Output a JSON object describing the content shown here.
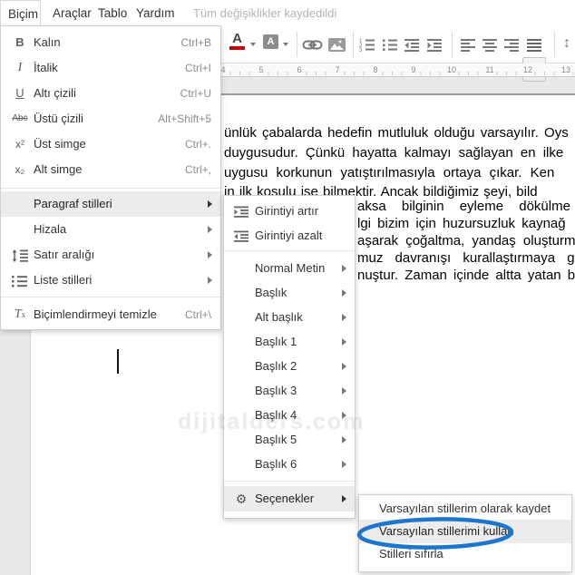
{
  "menubar": {
    "items": [
      {
        "label": "Biçim"
      },
      {
        "label": "Araçlar"
      },
      {
        "label": "Tablo"
      },
      {
        "label": "Yardım"
      }
    ],
    "status": "Tüm değişiklikler kaydedildi"
  },
  "toolbar": {
    "icons": [
      "text-color",
      "highlight-color",
      "insert-link",
      "insert-image",
      "numbered-list",
      "bulleted-list",
      "decrease-indent",
      "increase-indent",
      "align-left",
      "align-center",
      "align-right",
      "justify",
      "line-spacing"
    ],
    "justify_selected": true,
    "line_spacing_glyph": "↕"
  },
  "ruler": {
    "numbers": [
      "4",
      "5",
      "6",
      "7",
      "8",
      "9",
      "10",
      "11",
      "12",
      "13"
    ]
  },
  "format_menu": {
    "items": [
      {
        "label": "Kalın",
        "shortcut": "Ctrl+B"
      },
      {
        "label": "İtalik",
        "shortcut": "Ctrl+I"
      },
      {
        "label": "Altı çizili",
        "shortcut": "Ctrl+U"
      },
      {
        "label": "Üstü çizili",
        "shortcut": "Alt+Shift+5"
      },
      {
        "label": "Üst simge",
        "shortcut": "Ctrl+."
      },
      {
        "label": "Alt simge",
        "shortcut": "Ctrl+,"
      },
      {
        "label": "Paragraf stilleri"
      },
      {
        "label": "Hizala"
      },
      {
        "label": "Satır aralığı"
      },
      {
        "label": "Liste stilleri"
      },
      {
        "label": "Biçimlendirmeyi temizle",
        "shortcut": "Ctrl+\\"
      }
    ],
    "icon_glyphs": {
      "bold": "B",
      "italic": "I",
      "underline": "U",
      "strikethrough": "Abc",
      "superscript": "x²",
      "subscript": "x₂",
      "clear_t": "T",
      "clear_x": "x"
    }
  },
  "styles_submenu": {
    "items": [
      {
        "label": "Girintiyi artır"
      },
      {
        "label": "Girintiyi azalt"
      },
      {
        "label": "Normal Metin"
      },
      {
        "label": "Başlık"
      },
      {
        "label": "Alt başlık"
      },
      {
        "label": "Başlık 1"
      },
      {
        "label": "Başlık 2"
      },
      {
        "label": "Başlık 3"
      },
      {
        "label": "Başlık 4"
      },
      {
        "label": "Başlık 5"
      },
      {
        "label": "Başlık 6"
      },
      {
        "label": "Seçenekler"
      }
    ],
    "gear_glyph": "⚙"
  },
  "options_submenu": {
    "items": [
      {
        "label": "Varsayılan stillerim olarak kaydet"
      },
      {
        "label": "Varsayılan stillerimi kullan",
        "highlighted": true,
        "circled": true
      },
      {
        "label": "Stilleri sıfırla"
      }
    ]
  },
  "document": {
    "lines": [
      "ünlük çabalarda hedefin mutluluk olduğu varsayılır. Oys",
      "duygusudur. Çünkü hayatta kalmayı sağlayan en ilke",
      "uygusu korkunun yatıştırılmasıyla ortaya çıkar. Ken",
      "in ilk koşulu ise bilmektir. Ancak bildiğimiz şeyi, bild",
      "aksa bilginin eyleme dökülme",
      "lgi bizim için huzursuzluk kaynağ",
      "aşarak çoğaltma, yandaş oluşturm",
      "muz davranışı kurallaştırmaya g",
      "nuştur. Zaman içinde altta yatan b"
    ],
    "watermark": "dijitalders.com"
  },
  "colors": {
    "accent_red": "#cc0000",
    "annotation_blue": "#1d76cb",
    "menu_highlight": "#ececec"
  }
}
